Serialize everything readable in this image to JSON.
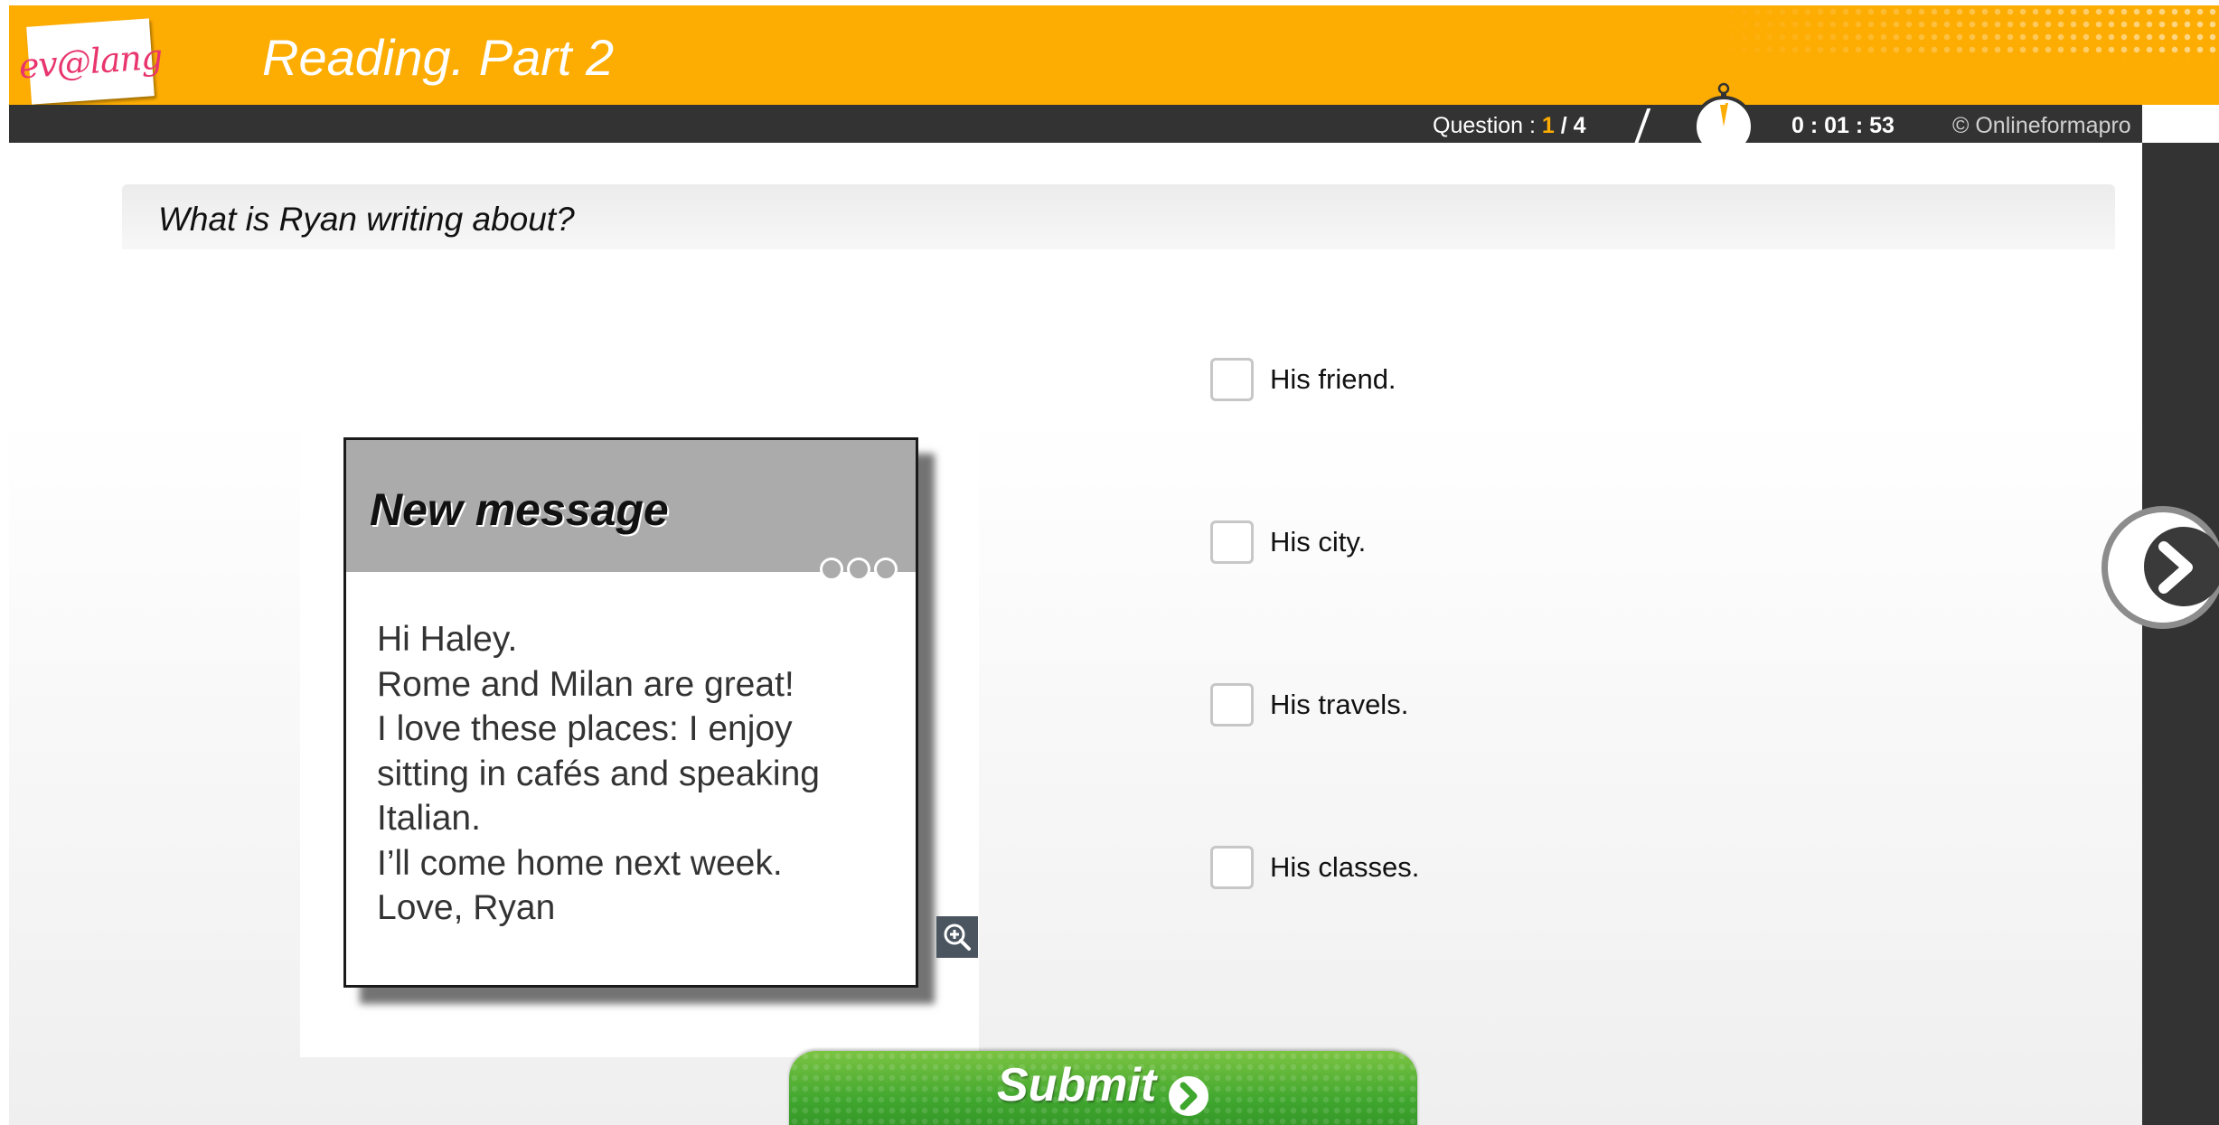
{
  "header": {
    "logo_text": "ev@lang",
    "title": "Reading. Part 2"
  },
  "infobar": {
    "question_prefix": "Question : ",
    "question_current": "1",
    "question_total": " / 4",
    "timer": "0 : 01 : 53",
    "copyright": "© Onlineformapro"
  },
  "question": {
    "text": "What is Ryan writing about?"
  },
  "message": {
    "title": "New message",
    "lines": [
      "Hi Haley.",
      "Rome and Milan are great!",
      "I love these places: I enjoy",
      "sitting in cafés and speaking",
      "Italian.",
      "I’ll come home next week.",
      "Love, Ryan"
    ]
  },
  "options": [
    {
      "label": "His friend.",
      "checked": false
    },
    {
      "label": "His city.",
      "checked": false
    },
    {
      "label": "His travels.",
      "checked": false
    },
    {
      "label": "His classes.",
      "checked": false
    }
  ],
  "submit": {
    "label": "Submit"
  },
  "icons": {
    "timer": "stopwatch-icon",
    "zoom": "zoom-in-icon",
    "next": "chevron-right-icon",
    "submit": "arrow-circle-right-icon"
  },
  "colors": {
    "header_orange": "#fdac02",
    "bar_dark": "#333333",
    "submit_green": "#3fa62e",
    "logo_pink": "#e8356d"
  }
}
